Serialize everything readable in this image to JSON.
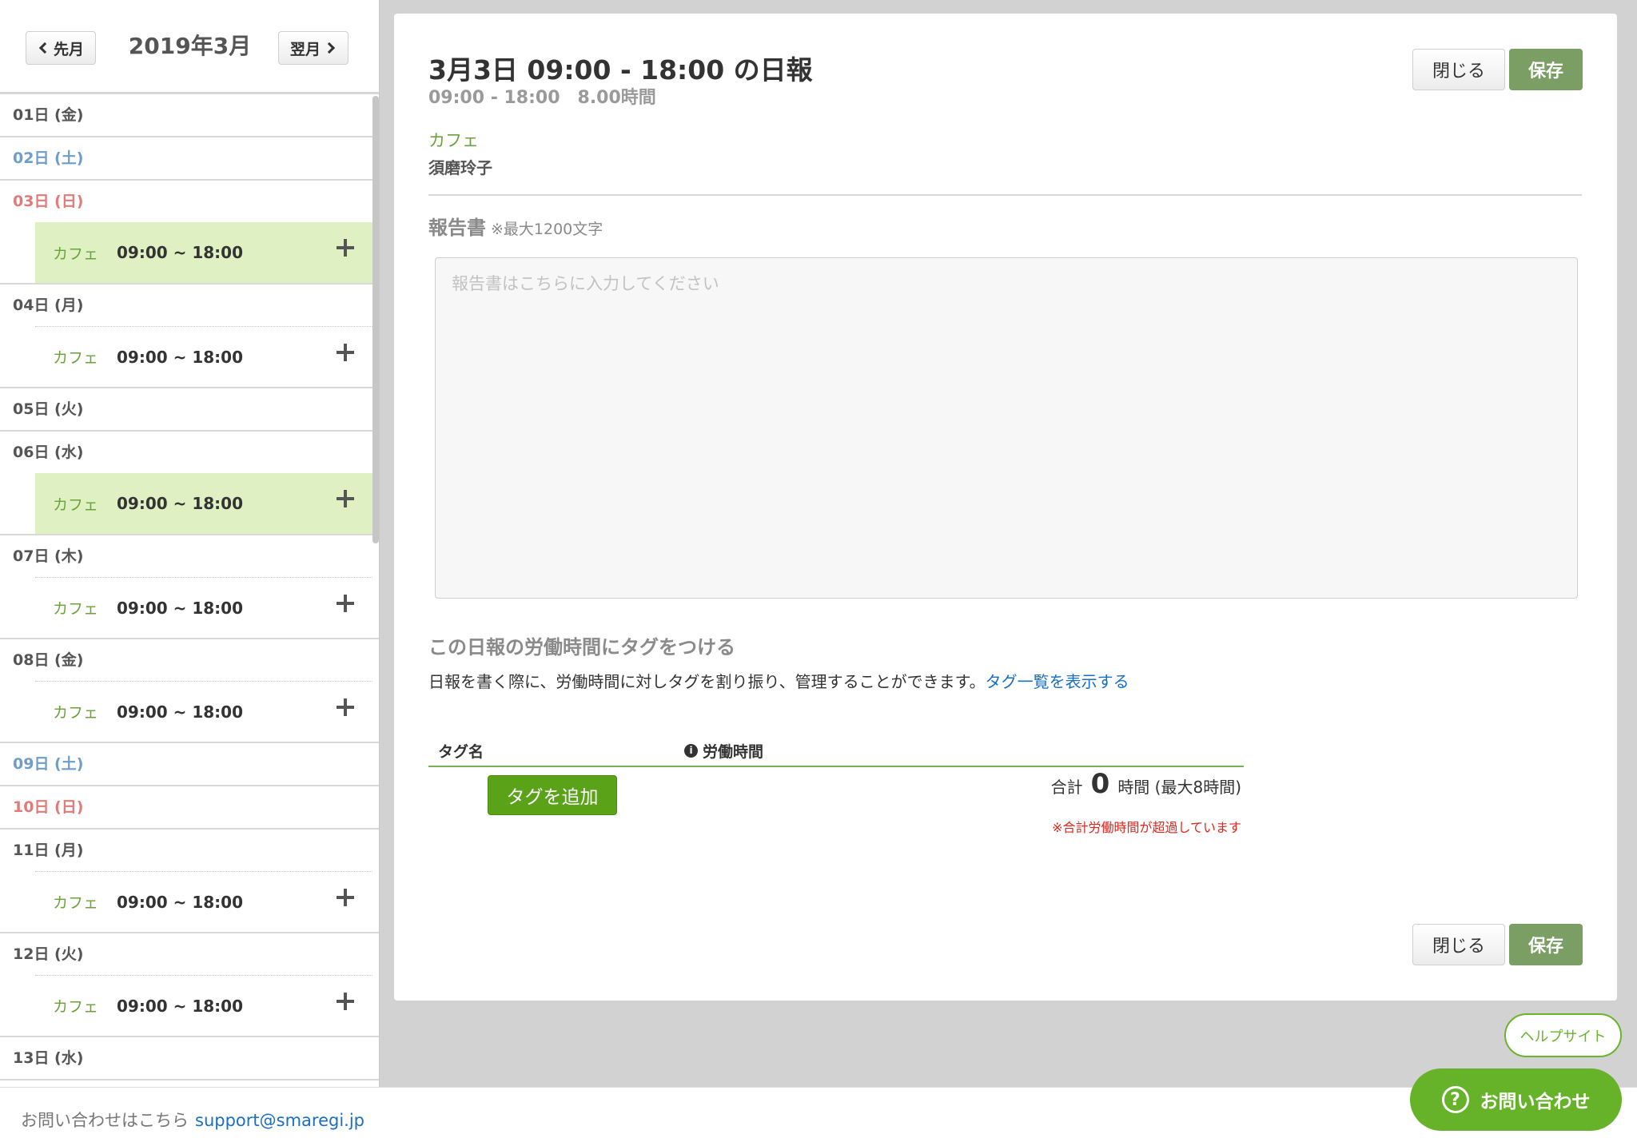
{
  "sidebar": {
    "prev_label": "先月",
    "next_label": "翌月",
    "month_title": "2019年3月",
    "days": [
      {
        "label": "01日 (金)",
        "type": "weekday",
        "shifts": []
      },
      {
        "label": "02日 (土)",
        "type": "sat",
        "shifts": []
      },
      {
        "label": "03日 (日)",
        "type": "sun",
        "shifts": [
          {
            "store": "カフェ",
            "time": "09:00 ~ 18:00",
            "active": true
          }
        ]
      },
      {
        "label": "04日 (月)",
        "type": "weekday",
        "shifts": [
          {
            "store": "カフェ",
            "time": "09:00 ~ 18:00",
            "active": false
          }
        ]
      },
      {
        "label": "05日 (火)",
        "type": "weekday",
        "shifts": []
      },
      {
        "label": "06日 (水)",
        "type": "weekday",
        "shifts": [
          {
            "store": "カフェ",
            "time": "09:00 ~ 18:00",
            "active": true
          }
        ]
      },
      {
        "label": "07日 (木)",
        "type": "weekday",
        "shifts": [
          {
            "store": "カフェ",
            "time": "09:00 ~ 18:00",
            "active": false
          }
        ]
      },
      {
        "label": "08日 (金)",
        "type": "weekday",
        "shifts": [
          {
            "store": "カフェ",
            "time": "09:00 ~ 18:00",
            "active": false
          }
        ]
      },
      {
        "label": "09日 (土)",
        "type": "sat",
        "shifts": []
      },
      {
        "label": "10日 (日)",
        "type": "sun",
        "shifts": []
      },
      {
        "label": "11日 (月)",
        "type": "weekday",
        "shifts": [
          {
            "store": "カフェ",
            "time": "09:00 ~ 18:00",
            "active": false
          }
        ]
      },
      {
        "label": "12日 (火)",
        "type": "weekday",
        "shifts": [
          {
            "store": "カフェ",
            "time": "09:00 ~ 18:00",
            "active": false
          }
        ]
      },
      {
        "label": "13日 (水)",
        "type": "weekday",
        "shifts": []
      }
    ]
  },
  "report": {
    "title": "3月3日 09:00 - 18:00 の日報",
    "subtitle": "09:00 - 18:00　8.00時間",
    "store": "カフェ",
    "staff": "須磨玲子",
    "close_label": "閉じる",
    "save_label": "保存",
    "report_label": "報告書",
    "report_note": "※最大1200文字",
    "report_placeholder": "報告書はこちらに入力してください",
    "tag_heading": "この日報の労働時間にタグをつける",
    "tag_desc": "日報を書く際に、労働時間に対しタグを割り振り、管理することができます。",
    "tag_link": "タグ一覧を表示する",
    "col_tag": "タグ名",
    "col_hours": "労働時間",
    "add_tag_label": "タグを追加",
    "total_label": "合計",
    "total_value": "0",
    "total_unit": "時間 (最大8時間)",
    "total_warning": "※合計労働時間が超過しています"
  },
  "footer": {
    "text": "お問い合わせはこちら",
    "email": "support@smaregi.jp",
    "help_label": "ヘルプサイト",
    "contact_label": "お問い合わせ"
  },
  "colors": {
    "accent_green": "#66b32a",
    "save_green": "#7a9e64",
    "active_shift": "#dff1c3",
    "sat_blue": "#6e9dc9",
    "sun_red": "#e27a7a",
    "warning_red": "#e0261b",
    "link_blue": "#1a6fc4"
  }
}
